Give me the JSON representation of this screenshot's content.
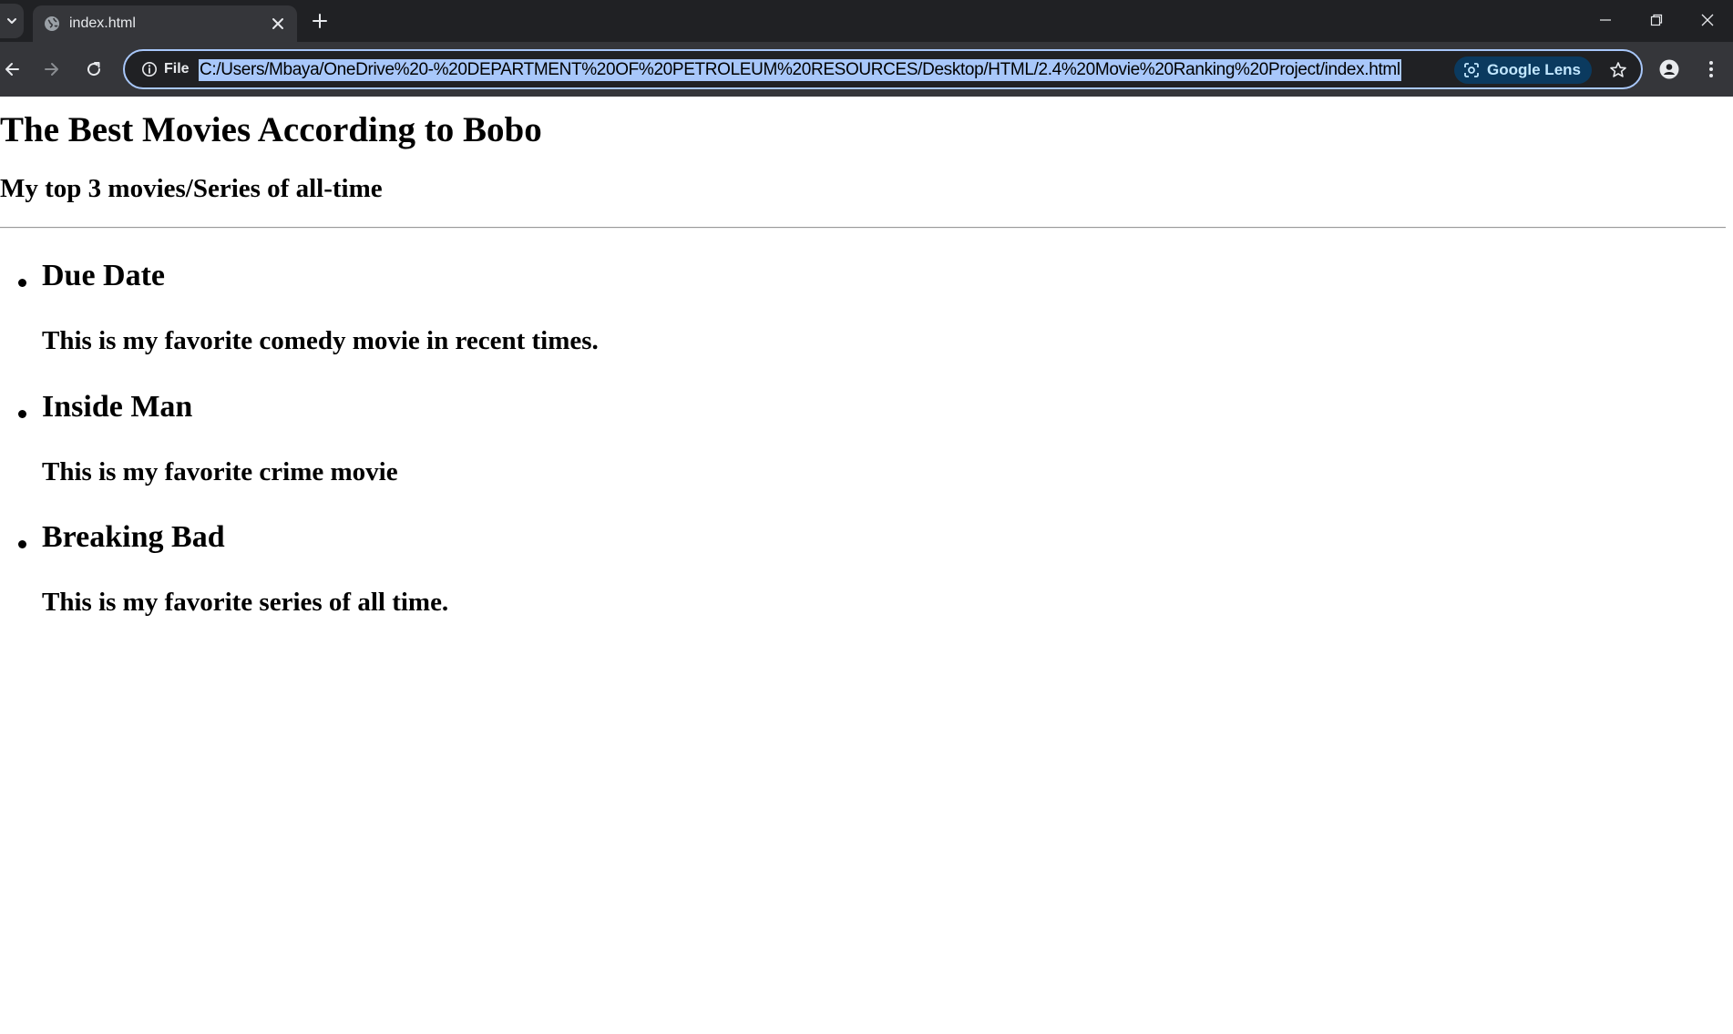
{
  "browser": {
    "tab": {
      "title": "index.html",
      "favicon": "globe-icon"
    },
    "site_info_label": "File",
    "url": "C:/Users/Mbaya/OneDrive%20-%20DEPARTMENT%20OF%20PETROLEUM%20RESOURCES/Desktop/HTML/2.4%20Movie%20Ranking%20Project/index.html",
    "lens_label": "Google Lens",
    "colors": {
      "tabstrip": "#202124",
      "toolbar": "#35363a",
      "omnibox_border": "#a8c7fa",
      "url_highlight": "#a8c7fa",
      "lens_chip": "#0b3a5f"
    }
  },
  "page": {
    "title": "The Best Movies According to Bobo",
    "subtitle": "My top 3 movies/Series of all-time",
    "movies": [
      {
        "title": "Due Date",
        "description": "This is my favorite comedy movie in recent times."
      },
      {
        "title": "Inside Man",
        "description": "This is my favorite crime movie"
      },
      {
        "title": "Breaking Bad",
        "description": "This is my favorite series of all time."
      }
    ]
  }
}
